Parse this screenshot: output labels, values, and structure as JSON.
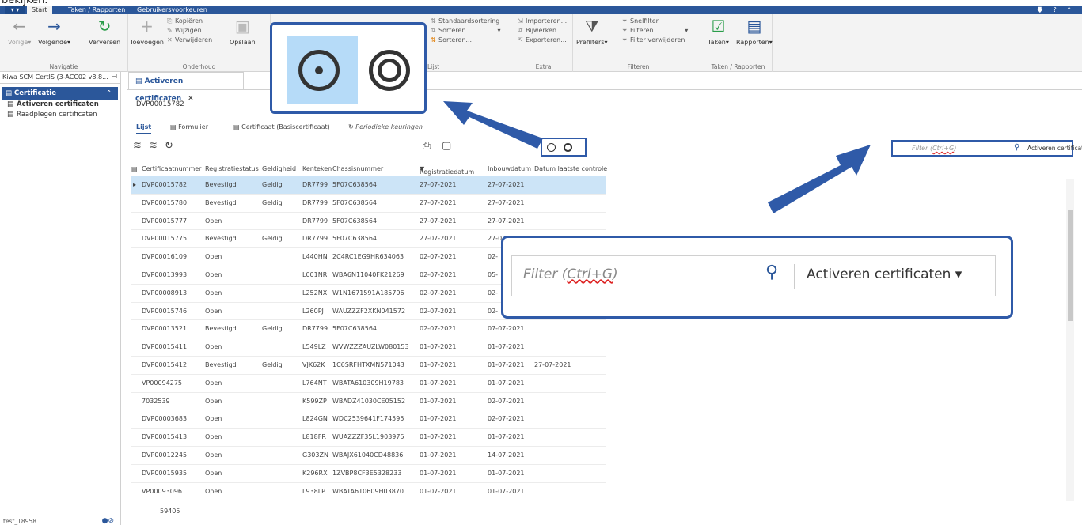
{
  "top_text": "bekijken.",
  "titlebar": {
    "qa": "▾ ▾",
    "tabs": [
      "Start",
      "Taken / Rapporten",
      "Gebruikersvoorkeuren"
    ],
    "right": "🡇 ? ⌃"
  },
  "ribbon": {
    "vorige": "Vorige",
    "volgende": "Volgende",
    "verversen": "Verversen",
    "nav_label": "Navigatie",
    "toevoegen": "Toevoegen",
    "kopieren": "Kopiëren",
    "wijzigen": "Wijzigen",
    "verwijderen": "Verwijderen",
    "opslaan": "Opslaan",
    "onderhoud_label": "Onderhoud",
    "standaardsortering": "Standaardsortering",
    "sorteren1": "Sorteren",
    "sorteren2": "Sorteren...",
    "lijst_label": "Lijst",
    "importeren": "Importeren...",
    "bijwerken": "Bijwerken...",
    "exporteren": "Exporteren...",
    "extra_label": "Extra",
    "prefilters": "Prefilters",
    "snelfilter": "Snelfilter",
    "filteren": "Filteren...",
    "filter_verwijderen": "Filter verwijderen",
    "filteren_label": "Filteren",
    "taken": "Taken",
    "rapporten": "Rapporten",
    "taken_label": "Taken / Rapporten"
  },
  "leftpanel": {
    "title": "Kiwa SCM CertIS (3-ACC02 v8.8...",
    "category": "Certificatie",
    "items": [
      "Activeren certificaten",
      "Raadplegen certificaten"
    ],
    "footer": "test_18958"
  },
  "doc": {
    "tab": "Activeren certificaten",
    "record": "DVP00015782",
    "subtabs": [
      "Lijst",
      "Formulier",
      "Certificaat (Basiscertificaat)",
      "Periodieke keuringen"
    ]
  },
  "filter": {
    "placeholder_pre": "Filter (",
    "placeholder_u": "Ctrl+G",
    "placeholder_post": ")",
    "dropdown": "Activeren certificaten"
  },
  "grid": {
    "headers": [
      "Certificaatnummer",
      "Registratiestatus",
      "Geldigheid",
      "Kenteken",
      "Chassisnummer",
      "Registratiedatum",
      "Inbouwdatum",
      "Datum laatste controle"
    ],
    "rows": [
      [
        "DVP00015782",
        "Bevestigd",
        "Geldig",
        "DR7799",
        "5F07C638564",
        "27-07-2021",
        "27-07-2021",
        ""
      ],
      [
        "DVP00015780",
        "Bevestigd",
        "Geldig",
        "DR7799",
        "5F07C638564",
        "27-07-2021",
        "27-07-2021",
        ""
      ],
      [
        "DVP00015777",
        "Open",
        "",
        "DR7799",
        "5F07C638564",
        "27-07-2021",
        "27-07-2021",
        ""
      ],
      [
        "DVP00015775",
        "Bevestigd",
        "Geldig",
        "DR7799",
        "5F07C638564",
        "27-07-2021",
        "27-07",
        ""
      ],
      [
        "DVP00016109",
        "Open",
        "",
        "L440HN",
        "2C4RC1EG9HR634063",
        "02-07-2021",
        "02-",
        ""
      ],
      [
        "DVP00013993",
        "Open",
        "",
        "L001NR",
        "WBA6N11040FK21269",
        "02-07-2021",
        "05-",
        ""
      ],
      [
        "DVP00008913",
        "Open",
        "",
        "L252NX",
        "W1N1671591A185796",
        "02-07-2021",
        "02-",
        ""
      ],
      [
        "DVP00015746",
        "Open",
        "",
        "L260PJ",
        "WAUZZZF2XKN041572",
        "02-07-2021",
        "02-",
        ""
      ],
      [
        "DVP00013521",
        "Bevestigd",
        "Geldig",
        "DR7799",
        "5F07C638564",
        "02-07-2021",
        "07-07-2021",
        ""
      ],
      [
        "DVP00015411",
        "Open",
        "",
        "L549LZ",
        "WVWZZZAUZLW080153",
        "01-07-2021",
        "01-07-2021",
        ""
      ],
      [
        "DVP00015412",
        "Bevestigd",
        "Geldig",
        "VJK62K",
        "1C6SRFHTXMN571043",
        "01-07-2021",
        "01-07-2021",
        "27-07-2021"
      ],
      [
        "VP00094275",
        "Open",
        "",
        "L764NT",
        "WBATA610309H19783",
        "01-07-2021",
        "01-07-2021",
        ""
      ],
      [
        "7032539",
        "Open",
        "",
        "K599ZP",
        "WBADZ41030CE05152",
        "01-07-2021",
        "02-07-2021",
        ""
      ],
      [
        "DVP00003683",
        "Open",
        "",
        "L824GN",
        "WDC2539641F174595",
        "01-07-2021",
        "02-07-2021",
        ""
      ],
      [
        "DVP00015413",
        "Open",
        "",
        "L818FR",
        "WUAZZZF35L1903975",
        "01-07-2021",
        "01-07-2021",
        ""
      ],
      [
        "DVP00012245",
        "Open",
        "",
        "G303ZN",
        "WBAJX61040CD48836",
        "01-07-2021",
        "14-07-2021",
        ""
      ],
      [
        "DVP00015935",
        "Open",
        "",
        "K296RX",
        "1ZVBP8CF3E5328233",
        "01-07-2021",
        "01-07-2021",
        ""
      ],
      [
        "VP00093096",
        "Open",
        "",
        "L938LP",
        "WBATA610609H03870",
        "01-07-2021",
        "01-07-2021",
        ""
      ]
    ],
    "count": "59405"
  },
  "colors": {
    "accent": "#2b579a",
    "callout": "#2f5aa8",
    "selected_row": "#cce4f7"
  }
}
